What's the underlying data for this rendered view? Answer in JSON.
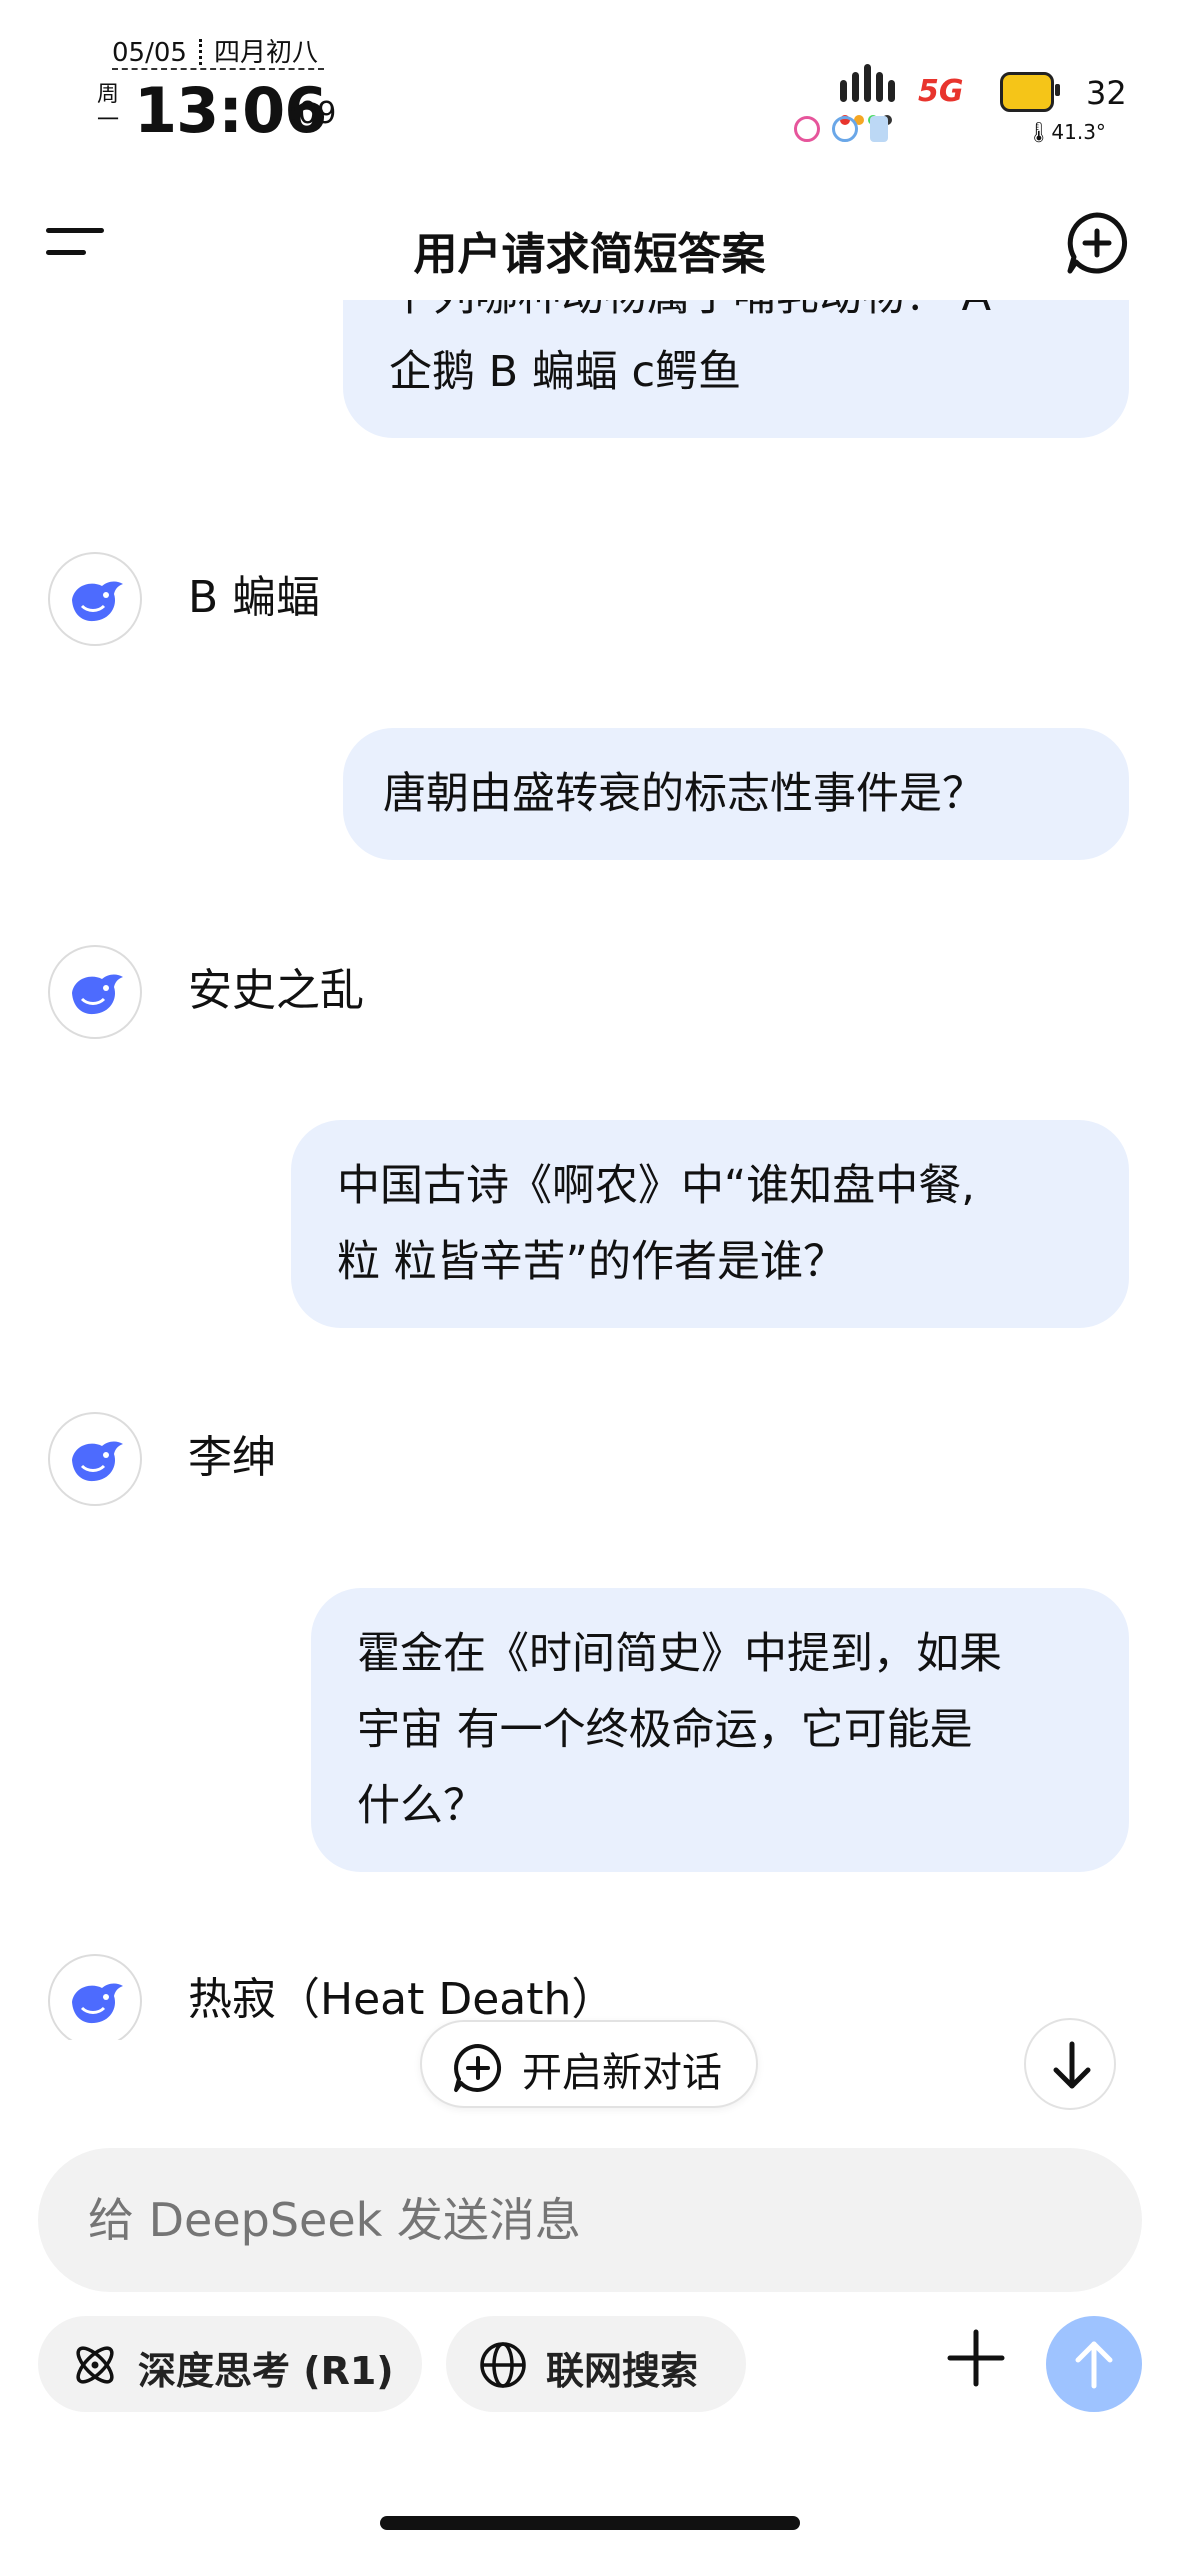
{
  "status_bar": {
    "date": "05/05",
    "lunar_date": "四月初八",
    "weekday": "周一",
    "time": "13:06",
    "seconds": ":09",
    "network": "5G",
    "battery": "32",
    "temperature": "41.3°"
  },
  "header": {
    "title": "用户请求简短答案",
    "menu_icon": "menu-icon",
    "new_chat_icon": "plus-circle-icon"
  },
  "messages": [
    {
      "role": "user",
      "text_lines": [
        "下列哪种动物属于哺乳动物？ A",
        "企鹅 B 蝙蝠 c鳄鱼"
      ]
    },
    {
      "role": "assistant",
      "text": "B 蝙蝠"
    },
    {
      "role": "user",
      "text_lines": [
        "唐朝由盛转衰的标志性事件是？"
      ]
    },
    {
      "role": "assistant",
      "text": "安史之乱"
    },
    {
      "role": "user",
      "text_lines": [
        "中国古诗《啊农》中“谁知盘中餐,",
        "粒 粒皆辛苦”的作者是谁？"
      ]
    },
    {
      "role": "assistant",
      "text": "李绅"
    },
    {
      "role": "user",
      "text_lines": [
        "霍金在《时间简史》中提到，如果",
        "宇宙 有一个终极命运，它可能是",
        "什么？"
      ]
    },
    {
      "role": "assistant",
      "text": "热寂（Heat Death）"
    }
  ],
  "floating": {
    "new_chat_label": "开启新对话",
    "scroll_down_icon": "arrow-down-icon"
  },
  "composer": {
    "placeholder": "给 DeepSeek 发送消息",
    "deep_think_label": "深度思考 (R1)",
    "web_search_label": "联网搜索",
    "attach_icon": "plus-icon",
    "send_icon": "arrow-up-icon"
  },
  "colors": {
    "user_bubble": "#e9f0fd",
    "brand_blue": "#4d6bfe",
    "send_button": "#9ec3ff",
    "input_bg": "#f2f2f2"
  }
}
